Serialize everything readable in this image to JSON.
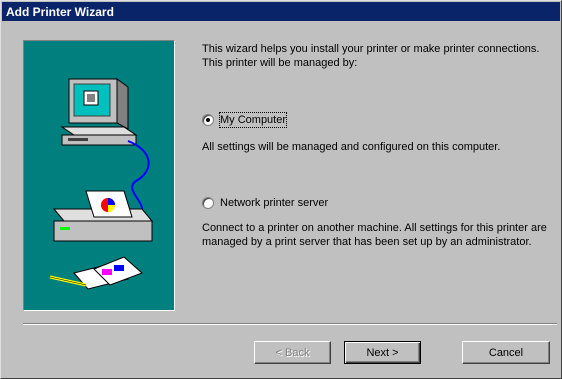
{
  "window": {
    "title": "Add Printer Wizard"
  },
  "intro": "This wizard helps you install your printer or make printer connections.  This printer will be managed by:",
  "options": [
    {
      "label": "My Computer",
      "checked": true,
      "description": "All settings will be managed and configured on this computer."
    },
    {
      "label": "Network printer server",
      "checked": false,
      "description": "Connect to a printer on another machine.  All settings for this printer are managed by a print server that has been set up by an administrator."
    }
  ],
  "buttons": {
    "back": "< Back",
    "next": "Next >",
    "cancel": "Cancel"
  },
  "colors": {
    "titlebar": "#0a246a",
    "illustration_bg": "#007f7f",
    "face": "#c0c0c0"
  }
}
